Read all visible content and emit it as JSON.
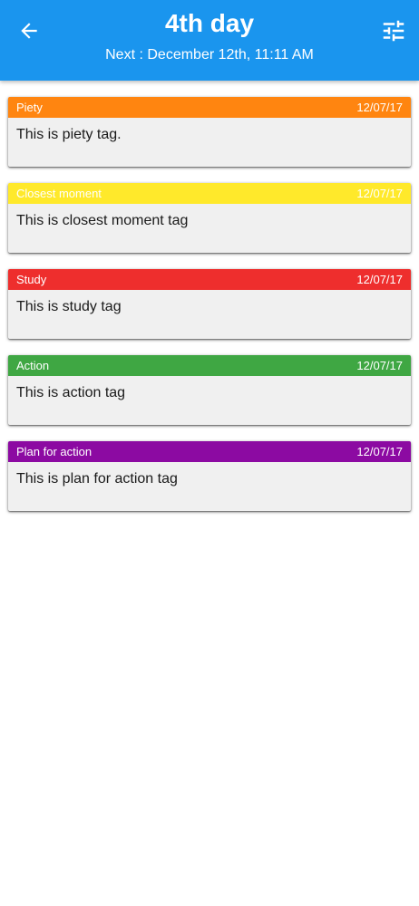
{
  "header": {
    "title": "4th day",
    "subtitle": "Next : December 12th, 11:11 AM",
    "back_icon": "arrow-left-icon",
    "filter_icon": "tune-sliders-icon",
    "background_color": "#1a95ee"
  },
  "tags": [
    {
      "name": "Piety",
      "date": "12/07/17",
      "text": "This is piety tag.",
      "color": "#ff8510"
    },
    {
      "name": "Closest moment",
      "date": "12/07/17",
      "text": "This is closest moment tag",
      "color": "#ffe92b"
    },
    {
      "name": "Study",
      "date": "12/07/17",
      "text": "This is study tag",
      "color": "#ee2e2d"
    },
    {
      "name": "Action",
      "date": "12/07/17",
      "text": "This is action tag",
      "color": "#3fa743"
    },
    {
      "name": "Plan for action",
      "date": "12/07/17",
      "text": "This is plan for action tag",
      "color": "#8c0aa2"
    }
  ]
}
